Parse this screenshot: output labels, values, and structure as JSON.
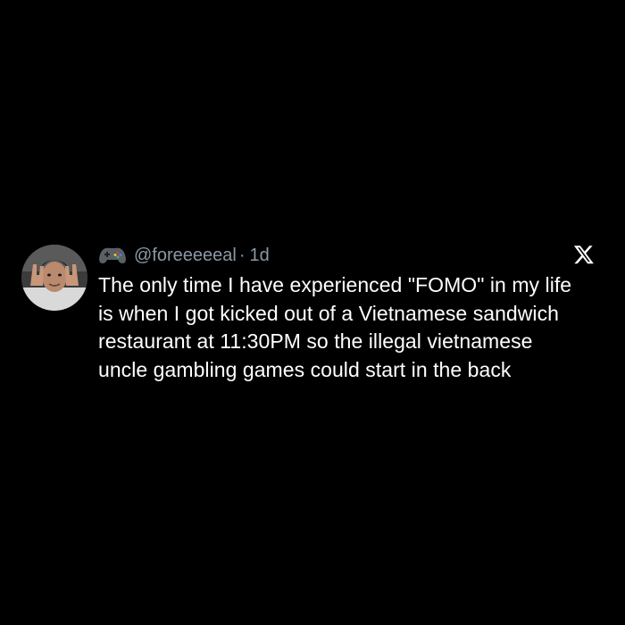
{
  "tweet": {
    "handle": "@foreeeeeal",
    "separator": "·",
    "time": "1d",
    "name_emoji": "video-game-controller-emoji",
    "platform_icon": "x-logo-icon",
    "text_lines": [
      "The only time I have experienced \"FOMO\" in my life",
      "is when I got kicked out of a Vietnamese sandwich",
      "restaurant at 11:30PM so the illegal vietnamese",
      "uncle gambling games could start in the back"
    ]
  },
  "colors": {
    "background": "#000000",
    "text": "#ffffff",
    "secondary_text": "#8b98a5"
  }
}
